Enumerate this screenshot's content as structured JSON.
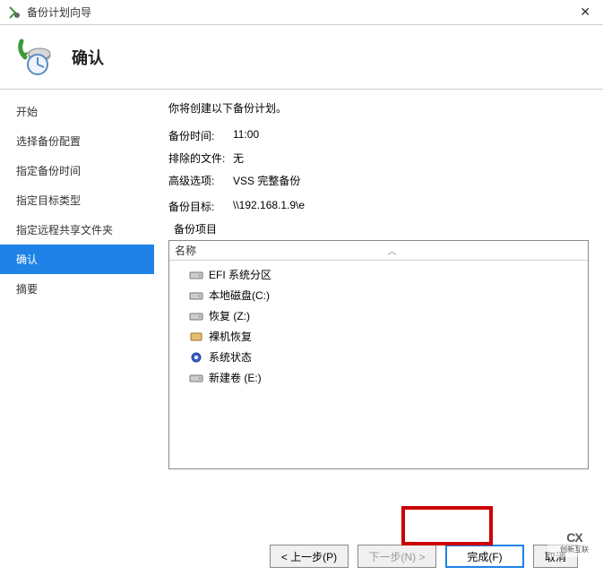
{
  "window": {
    "title": "备份计划向导"
  },
  "header": {
    "heading": "确认"
  },
  "sidebar": {
    "items": [
      {
        "label": "开始"
      },
      {
        "label": "选择备份配置"
      },
      {
        "label": "指定备份时间"
      },
      {
        "label": "指定目标类型"
      },
      {
        "label": "指定远程共享文件夹"
      },
      {
        "label": "确认"
      },
      {
        "label": "摘要"
      }
    ],
    "active_index": 5
  },
  "main": {
    "intro": "你将创建以下备份计划。",
    "rows": [
      {
        "label": "备份时间:",
        "value": "11:00"
      },
      {
        "label": "排除的文件:",
        "value": "无"
      },
      {
        "label": "高级选项:",
        "value": "VSS 完整备份"
      },
      {
        "label": "备份目标:",
        "value": "\\\\192.168.1.9\\e"
      }
    ],
    "items_label": "备份项目",
    "list": {
      "column": "名称",
      "items": [
        {
          "icon": "drive",
          "label": "EFI 系统分区"
        },
        {
          "icon": "drive",
          "label": "本地磁盘(C:)"
        },
        {
          "icon": "drive",
          "label": "恢复 (Z:)"
        },
        {
          "icon": "bare",
          "label": "裸机恢复"
        },
        {
          "icon": "gear",
          "label": "系统状态"
        },
        {
          "icon": "drive",
          "label": "新建卷 (E:)"
        }
      ]
    }
  },
  "footer": {
    "prev": "< 上一步(P)",
    "next": "下一步(N) >",
    "finish": "完成(F)",
    "cancel": "取消"
  },
  "watermark": {
    "top": "CX",
    "bottom": "创新互联"
  }
}
